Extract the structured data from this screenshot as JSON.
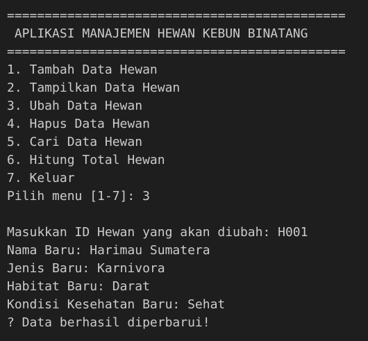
{
  "terminal": {
    "lines": [
      "=============================================",
      " APLIKASI MANAJEMEN HEWAN KEBUN BINATANG",
      "=============================================",
      "1. Tambah Data Hewan",
      "2. Tampilkan Data Hewan",
      "3. Ubah Data Hewan",
      "4. Hapus Data Hewan",
      "5. Cari Data Hewan",
      "6. Hitung Total Hewan",
      "7. Keluar",
      "Pilih menu [1-7]: 3",
      "",
      "Masukkan ID Hewan yang akan diubah: H001",
      "Nama Baru: Harimau Sumatera",
      "Jenis Baru: Karnivora",
      "Habitat Baru: Darat",
      "Kondisi Kesehatan Baru: Sehat",
      "? Data berhasil diperbarui!"
    ]
  },
  "colors": {
    "background": "#1e1e1e",
    "text": "#cccccc"
  }
}
